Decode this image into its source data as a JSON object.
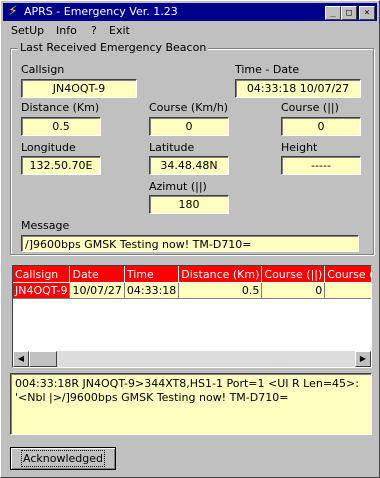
{
  "window": {
    "title": "APRS - Emergency  Ver. 1.23",
    "app_icon": "lightning-icon"
  },
  "title_buttons": {
    "minimize": "_",
    "maximize": "□",
    "close": "×"
  },
  "menu": [
    "SetUp",
    "Info",
    "?",
    "Exit"
  ],
  "group_title": "Last Received Emergency Beacon",
  "fields": {
    "callsign": {
      "label": "Callsign",
      "value": "JN4OQT-9"
    },
    "time_date": {
      "label": "Time - Date",
      "value": "04:33:18 10/07/27"
    },
    "distance": {
      "label": "Distance (Km)",
      "value": "0.5"
    },
    "course_kmh": {
      "label": "Course (Km/h)",
      "value": "0"
    },
    "course_deg": {
      "label": "Course (||)",
      "value": "0"
    },
    "longitude": {
      "label": "Longitude",
      "value": "132.50.70E"
    },
    "latitude": {
      "label": "Latitude",
      "value": "34.48.48N"
    },
    "height": {
      "label": "Height",
      "value": "-----"
    },
    "azimut": {
      "label": "Azimut (||)",
      "value": "180"
    },
    "message": {
      "label": "Message",
      "value": "/]9600bps GMSK Testing now! TM-D710="
    }
  },
  "table": {
    "columns": [
      "Callsign",
      "Date",
      "Time",
      "Distance (Km)",
      "Course (||)",
      "Course (Km"
    ],
    "rows": [
      [
        "JN4OQT-9",
        "10/07/27",
        "04:33:18",
        "0.5",
        "0",
        ""
      ]
    ]
  },
  "log": [
    "004:33:18R JN4OQT-9>344XT8,HS1-1 Port=1 <UI R Len=45>:",
    "'<Nbl |>/]9600bps GMSK Testing now! TM-D710="
  ],
  "ack_button": "Acknowledged"
}
